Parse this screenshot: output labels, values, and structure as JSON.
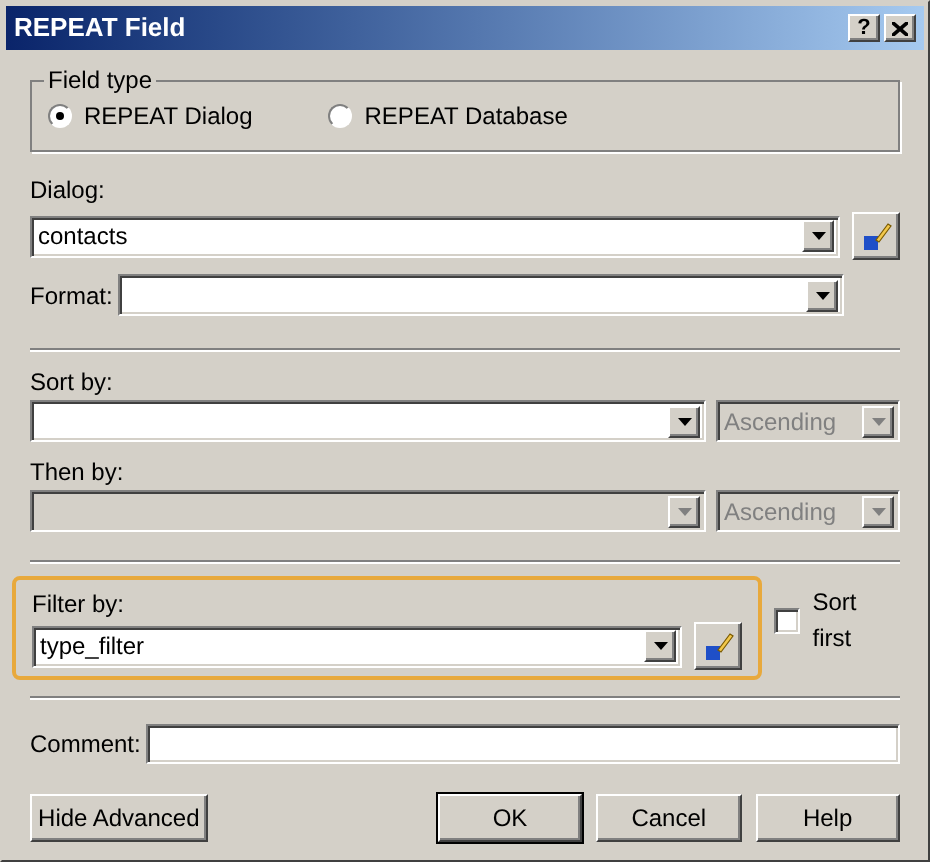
{
  "window": {
    "title": "REPEAT Field",
    "help_glyph": "?"
  },
  "field_type": {
    "legend": "Field type",
    "options": [
      {
        "label": "REPEAT Dialog",
        "selected": true
      },
      {
        "label": "REPEAT Database",
        "selected": false
      }
    ]
  },
  "dialog": {
    "label": "Dialog:",
    "value": "contacts"
  },
  "format": {
    "label": "Format:"
  },
  "sort_by": {
    "label": "Sort by:",
    "disabled": false,
    "order": {
      "value": "Ascending",
      "disabled": true
    }
  },
  "then_by": {
    "label": "Then by:",
    "disabled": true,
    "order": {
      "value": "Ascending",
      "disabled": true
    }
  },
  "filter_by": {
    "label": "Filter by:",
    "value": "type_filter",
    "highlighted": true
  },
  "sort_first": {
    "label": "Sort first",
    "checked": false
  },
  "comment": {
    "label": "Comment:"
  },
  "buttons": [
    {
      "label": "Hide Advanced",
      "default": false
    },
    {
      "label": "OK",
      "default": true
    },
    {
      "label": "Cancel",
      "default": false
    },
    {
      "label": "Help",
      "default": false
    }
  ]
}
